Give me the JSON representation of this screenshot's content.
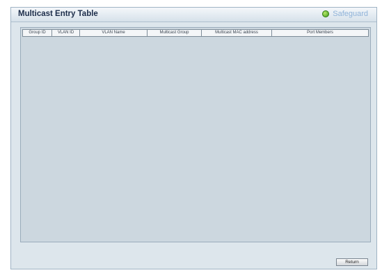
{
  "panel": {
    "title": "Multicast Entry Table",
    "badge": "Safeguard"
  },
  "table": {
    "columns": [
      "Group ID",
      "VLAN ID",
      "VLAN Name",
      "Multicast Group",
      "Multicast MAC address",
      "Port Members"
    ],
    "rows": []
  },
  "actions": {
    "return_label": "Return"
  }
}
